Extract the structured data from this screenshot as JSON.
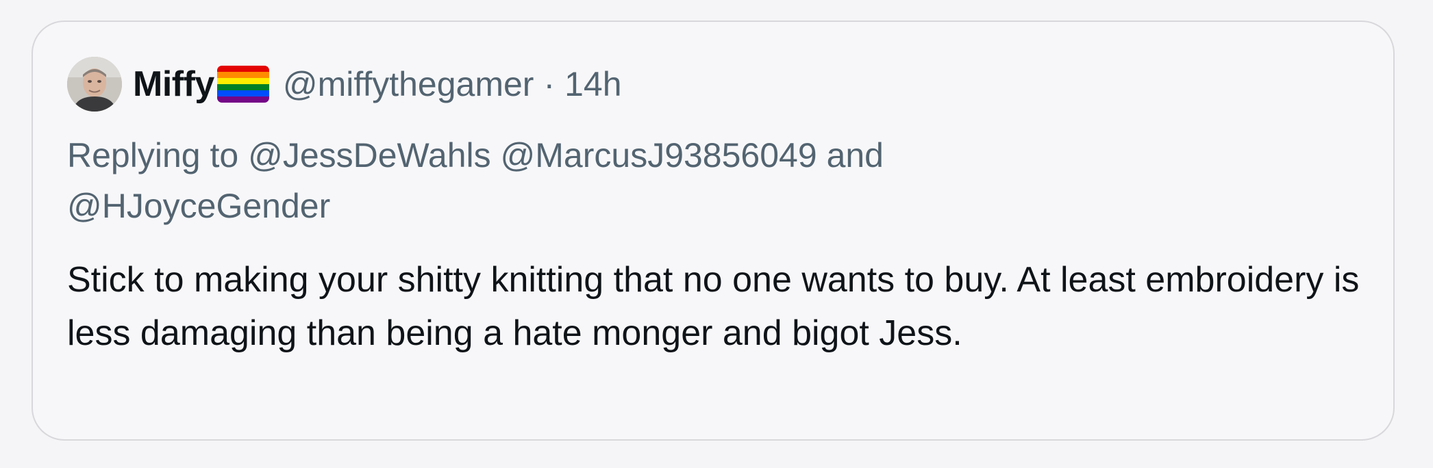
{
  "tweet": {
    "display_name": "Miffy",
    "handle": "@miffythegamer",
    "separator": "·",
    "time": "14h",
    "badge_icon": "rainbow-flag-icon",
    "flag_colors": [
      "#e40303",
      "#ff8c00",
      "#ffed00",
      "#008026",
      "#004dff",
      "#750787"
    ],
    "replying": {
      "prefix": "Replying to",
      "mentions": [
        "@JessDeWahls",
        "@MarcusJ93856049"
      ],
      "conjunction": "and",
      "last_mention": "@HJoyceGender"
    },
    "text": "Stick to making your shitty knitting that no one wants to buy. At least embroidery is less damaging than being a hate monger and bigot Jess."
  }
}
